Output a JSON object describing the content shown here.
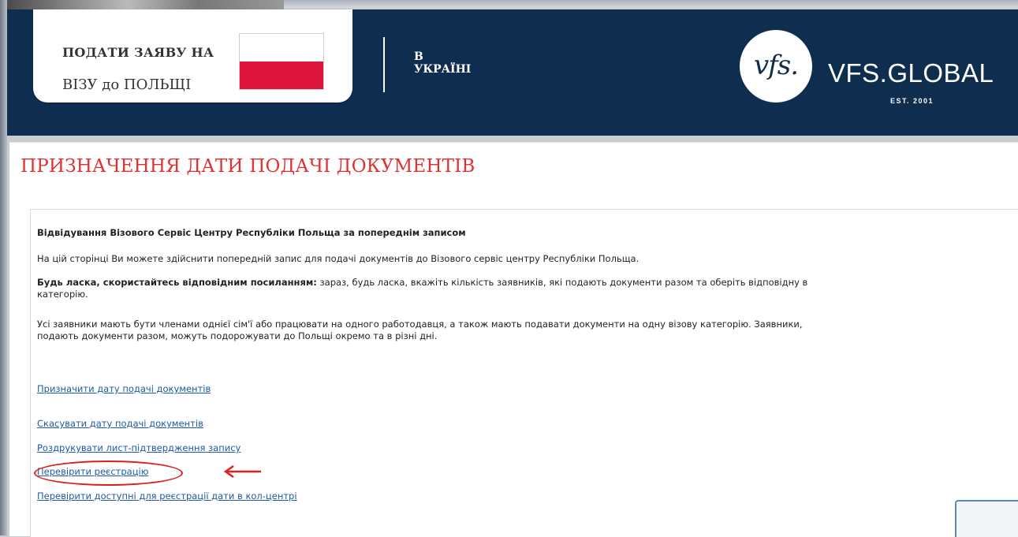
{
  "header": {
    "brand_line1": "ПОДАТИ ЗАЯВУ НА",
    "brand_line2": "ВІЗУ до ПОЛЬЩІ",
    "region_line1": "В",
    "region_line2": "УКРАЇНІ",
    "logo_mark": "vfs.",
    "logo_name": "VFS.GLOBAL",
    "logo_est": "EST. 2001",
    "colors": {
      "band": "#0f2d4f",
      "flag_white": "#ffffff",
      "flag_red": "#dc143c"
    }
  },
  "page": {
    "title": "ПРИЗНАЧЕННЯ ДАТИ ПОДАЧІ ДОКУМЕНТІВ",
    "title_color": "#e03030",
    "heading": "Відвідування Візового Сервіс Центру Республіки Польща за попереднім записом",
    "intro": "На цій сторінці Ви можете здійснити попередній запис для подачі документів до Візового сервіс центру Республіки Польща.",
    "hint_bold": "Будь ласка, скористайтесь відповідним посиланням:",
    "hint_rest": " зараз, будь ласка, вкажіть кількість заявників, які подають документи разом та оберіть відповідну в",
    "hint_line2": "категорію.",
    "members_line1": "Усі заявники мають бути членами однієї сім'ї або працювати на одного работодавця, а також мають подавати документи на одну візову категорію. Заявники,",
    "members_line2": "подають документи разом, можуть подорожувати до Польщі окремо та в різні дні."
  },
  "links": {
    "schedule": "Призначити дату подачі документів",
    "cancel": "Скасувати дату подачі документів",
    "print": "Роздрукувати лист-підтвердження запису",
    "check": "Перевірити реєстрацію",
    "callcenter": "Перевірити доступні для реєстрації дати в кол-центрі"
  },
  "annotation": {
    "arrow_symbol": "arrow-left",
    "color": "#e01e1e"
  }
}
